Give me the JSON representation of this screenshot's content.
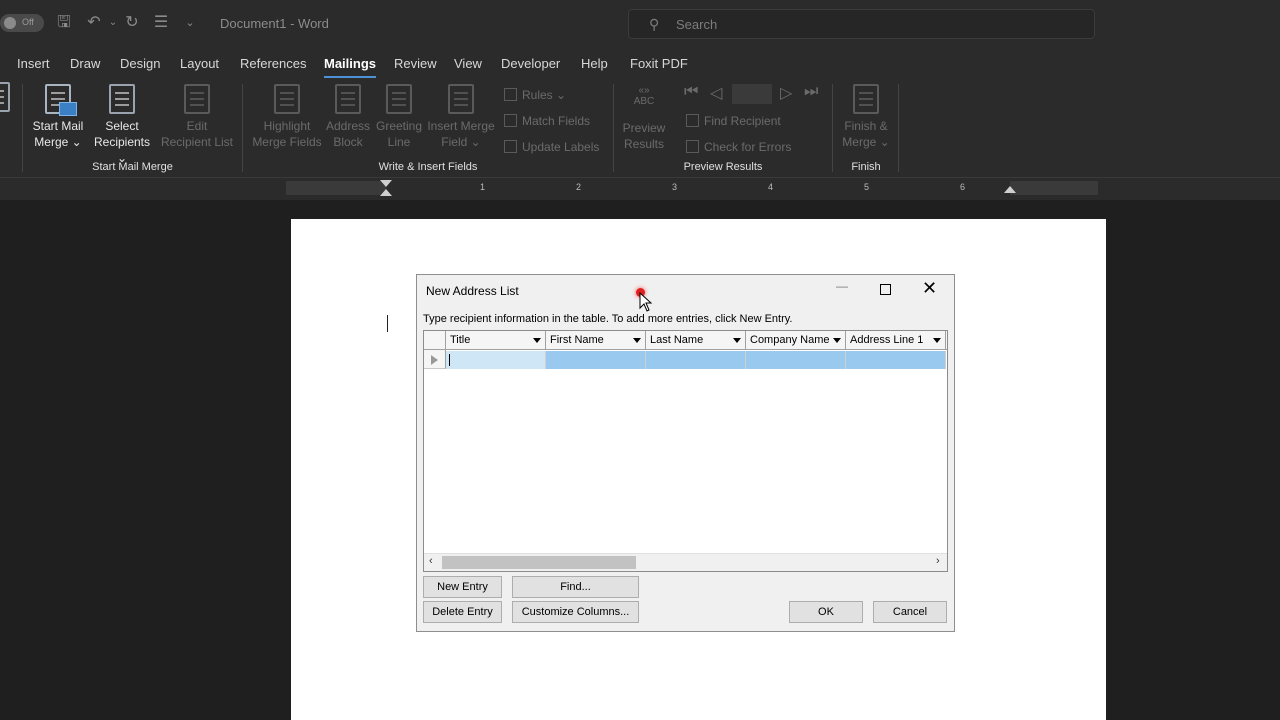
{
  "titlebar": {
    "autosave_label": "Off",
    "doc_title": "Document1 - Word",
    "search_placeholder": "Search"
  },
  "tabs": [
    "Insert",
    "Draw",
    "Design",
    "Layout",
    "References",
    "Mailings",
    "Review",
    "View",
    "Developer",
    "Help",
    "Foxit PDF"
  ],
  "active_tab": "Mailings",
  "ribbon": {
    "start_merge": {
      "edge_label": "ls",
      "start_mail_merge": [
        "Start Mail",
        "Merge ⌄"
      ],
      "select_recipients": [
        "Select",
        "Recipients ⌄"
      ],
      "edit_recipient_list": [
        "Edit",
        "Recipient List"
      ],
      "group_label": "Start Mail Merge"
    },
    "write_insert": {
      "highlight": [
        "Highlight",
        "Merge Fields"
      ],
      "address_block": [
        "Address",
        "Block"
      ],
      "greeting_line": [
        "Greeting",
        "Line"
      ],
      "insert_merge_field": [
        "Insert Merge",
        "Field ⌄"
      ],
      "rules": "Rules ⌄",
      "match_fields": "Match Fields",
      "update_labels": "Update Labels",
      "group_label": "Write & Insert Fields"
    },
    "preview": {
      "abc_top": "«»",
      "abc": "ABC",
      "preview_results": [
        "Preview",
        "Results"
      ],
      "find_recipient": "Find Recipient",
      "check_errors": "Check for Errors",
      "group_label": "Preview Results"
    },
    "finish": {
      "finish_merge": [
        "Finish &",
        "Merge ⌄"
      ],
      "group_label": "Finish"
    }
  },
  "ruler": {
    "numbers": [
      "1",
      "2",
      "3",
      "4",
      "5",
      "6"
    ]
  },
  "dialog": {
    "title": "New Address List",
    "instructions": "Type recipient information in the table.  To add more entries, click New Entry.",
    "columns": [
      "Title",
      "First Name",
      "Last Name",
      "Company Name",
      "Address Line 1"
    ],
    "buttons": {
      "new_entry": "New Entry",
      "find": "Find...",
      "delete_entry": "Delete Entry",
      "customize_columns": "Customize Columns...",
      "ok": "OK",
      "cancel": "Cancel"
    }
  }
}
